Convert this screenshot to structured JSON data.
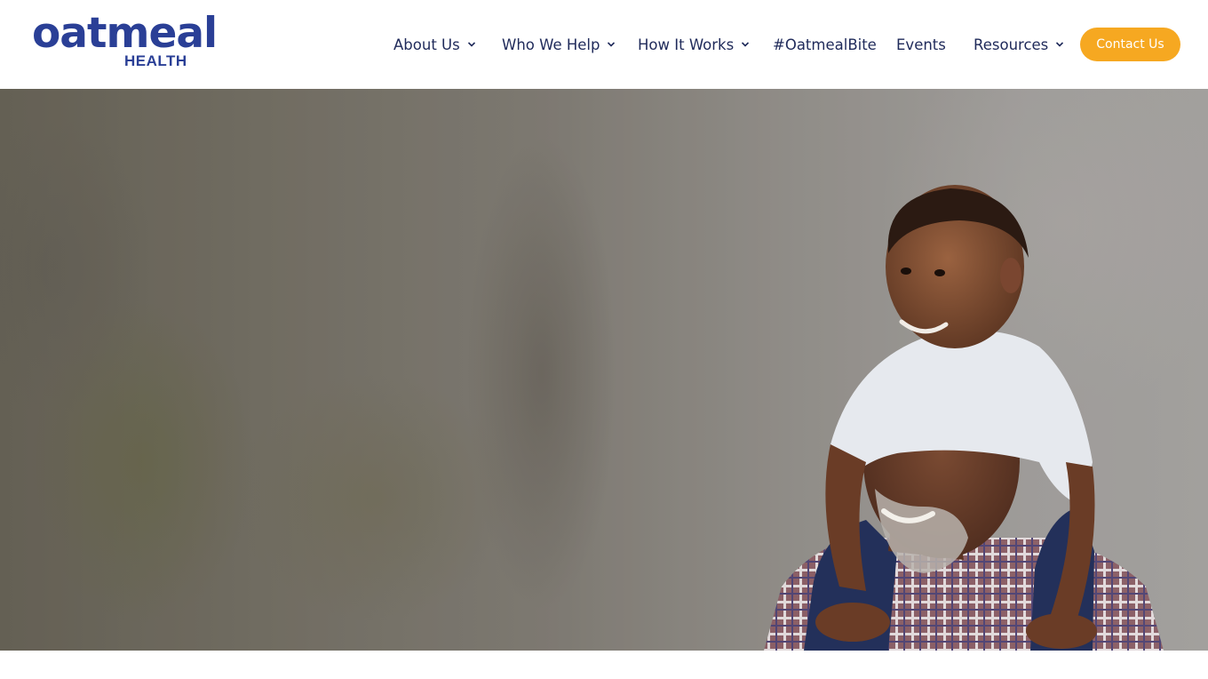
{
  "brand": {
    "name": "oatmeal",
    "sub": "HEALTH",
    "color": "#2a3f96"
  },
  "nav": {
    "items": [
      {
        "label": "About Us",
        "has_dropdown": true
      },
      {
        "label": "Who We Help",
        "has_dropdown": true
      },
      {
        "label": "How It Works",
        "has_dropdown": true
      },
      {
        "label": "#OatmealBite",
        "has_dropdown": false
      },
      {
        "label": "Events",
        "has_dropdown": false
      },
      {
        "label": "Resources",
        "has_dropdown": true
      }
    ],
    "chevron_icon": "chevron-down-icon"
  },
  "cta": {
    "label": "Contact Us",
    "color": "#f6a821"
  },
  "hero": {
    "image_icon": "hero-photo"
  }
}
